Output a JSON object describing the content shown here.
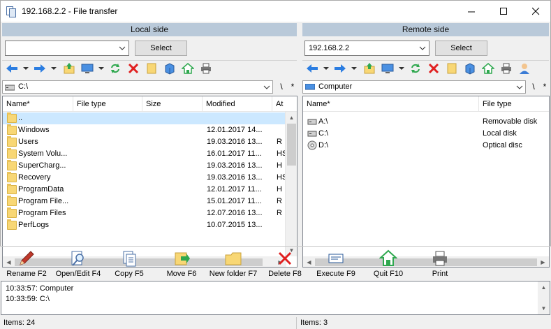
{
  "window": {
    "title": "192.168.2.2 - File transfer"
  },
  "local": {
    "header": "Local side",
    "combo_value": "",
    "select_label": "Select",
    "path": "C:\\",
    "path_btn_1": "\\",
    "path_btn_2": "*",
    "columns": [
      "Name*",
      "File type",
      "Size",
      "Modified",
      "At"
    ],
    "rows": [
      {
        "name": "..",
        "type": "",
        "size": "",
        "modified": "",
        "attr": ""
      },
      {
        "name": "Windows",
        "type": "",
        "size": "",
        "modified": "12.01.2017 14...",
        "attr": ""
      },
      {
        "name": "Users",
        "type": "",
        "size": "",
        "modified": "19.03.2016 13...",
        "attr": "R"
      },
      {
        "name": "System Volu...",
        "type": "",
        "size": "",
        "modified": "16.01.2017 11...",
        "attr": "HS"
      },
      {
        "name": "SuperCharg...",
        "type": "",
        "size": "",
        "modified": "19.03.2016 13...",
        "attr": "H"
      },
      {
        "name": "Recovery",
        "type": "",
        "size": "",
        "modified": "19.03.2016 13...",
        "attr": "HS"
      },
      {
        "name": "ProgramData",
        "type": "",
        "size": "",
        "modified": "12.01.2017 11...",
        "attr": "H"
      },
      {
        "name": "Program File...",
        "type": "",
        "size": "",
        "modified": "15.01.2017 11...",
        "attr": "R"
      },
      {
        "name": "Program Files",
        "type": "",
        "size": "",
        "modified": "12.07.2016 13...",
        "attr": "R"
      },
      {
        "name": "PerfLogs",
        "type": "",
        "size": "",
        "modified": "10.07.2015 13...",
        "attr": ""
      }
    ],
    "status": "Items: 24"
  },
  "remote": {
    "header": "Remote side",
    "combo_value": "192.168.2.2",
    "select_label": "Select",
    "path": "Computer",
    "path_btn_1": "\\",
    "path_btn_2": "*",
    "columns": [
      "Name*",
      "File type"
    ],
    "rows": [
      {
        "name": "A:\\",
        "type": "Removable disk"
      },
      {
        "name": "C:\\",
        "type": "Local disk"
      },
      {
        "name": "D:\\",
        "type": "Optical disc"
      }
    ],
    "status": "Items: 3"
  },
  "actions": [
    {
      "label": "Rename F2",
      "icon": "pencil-icon"
    },
    {
      "label": "Open/Edit F4",
      "icon": "open-edit-icon"
    },
    {
      "label": "Copy F5",
      "icon": "copy-icon"
    },
    {
      "label": "Move F6",
      "icon": "move-icon"
    },
    {
      "label": "New folder F7",
      "icon": "new-folder-icon"
    },
    {
      "label": "Delete F8",
      "icon": "delete-icon"
    },
    {
      "label": "Execute F9",
      "icon": "execute-icon"
    },
    {
      "label": "Quit F10",
      "icon": "quit-icon"
    },
    {
      "label": "Print",
      "icon": "print-icon"
    }
  ],
  "log": [
    "10:33:57: Computer",
    "10:33:59: C:\\"
  ],
  "colors": {
    "header_bg": "#b9c9d9",
    "selected_row": "#cce8ff",
    "folder": "#f8d775"
  }
}
